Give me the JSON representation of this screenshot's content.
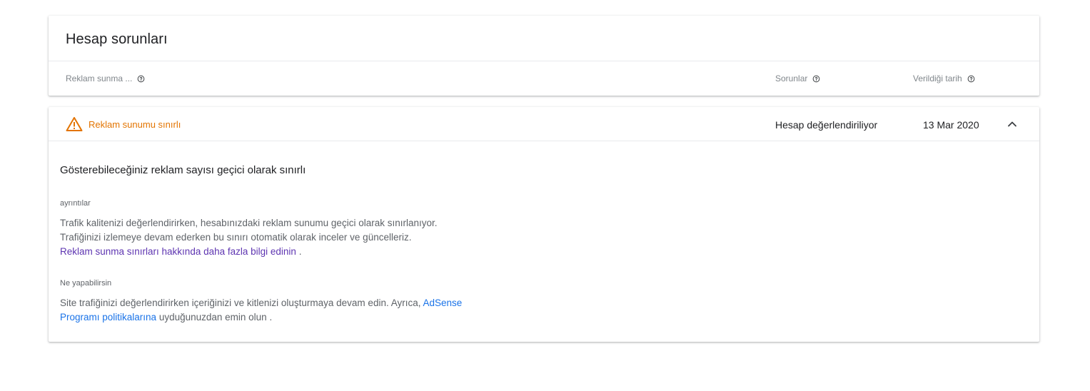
{
  "header_card": {
    "title": "Hesap sorunları",
    "columns": {
      "serving": "Reklam sunma ...",
      "issues": "Sorunlar",
      "date_issued": "Verildiği tarih"
    }
  },
  "issue_row": {
    "status_label": "Reklam sunumu sınırlı",
    "issue": "Hesap değerlendiriliyor",
    "date": "13 Mar 2020",
    "status_color": "#e37400"
  },
  "detail": {
    "title": "Gösterebileceğiniz reklam sayısı geçici olarak sınırlı",
    "details_label": "ayrıntılar",
    "details_text": "Trafik kalitenizi değerlendirirken, hesabınızdaki reklam sunumu geçici olarak sınırlanıyor. Trafiğinizi izlemeye devam ederken bu sınırı otomatik olarak inceler ve güncelleriz.",
    "details_link": "Reklam sunma sınırları hakkında daha fazla bilgi edinin",
    "details_end": ".",
    "actions_label": "Ne yapabilirsin",
    "actions_text": "Site trafiğinizi değerlendirirken içeriğinizi ve kitlenizi oluşturmaya devam edin. Ayrıca,",
    "actions_link": "AdSense Programı politikalarına",
    "actions_end": "uyduğunuzdan emin olun ."
  },
  "icons": {
    "help": "help-outline-icon",
    "warning": "warning-triangle-icon",
    "collapse": "chevron-up-icon"
  }
}
